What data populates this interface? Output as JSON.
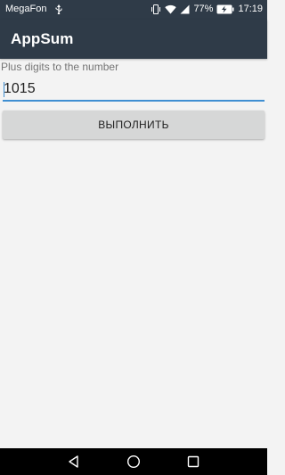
{
  "status_bar": {
    "carrier": "MegaFon",
    "battery_percent": "77%",
    "time": "17:19",
    "icons": [
      "usb-icon",
      "vibrate-icon",
      "wifi-icon",
      "signal-icon",
      "battery-charging-icon"
    ]
  },
  "app_bar": {
    "title": "AppSum",
    "color": "#2f3b48"
  },
  "form": {
    "label": "Plus digits to the number",
    "input_value": "1015",
    "button_label": "ВЫПОЛНИТЬ",
    "accent_color": "#3f8fd2"
  },
  "nav_bar": {
    "icons": [
      "back-icon",
      "home-icon",
      "recents-icon"
    ]
  }
}
